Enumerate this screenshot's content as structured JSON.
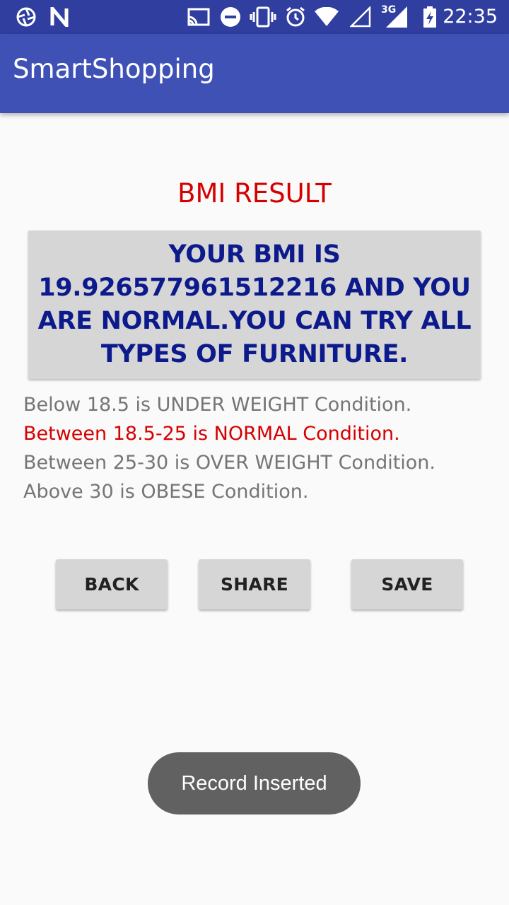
{
  "status_bar": {
    "time": "22:35",
    "network_type": "3G",
    "icons": [
      "aperture-icon",
      "n-icon",
      "cast-icon",
      "dnd-icon",
      "vibrate-icon",
      "alarm-icon",
      "wifi-icon",
      "signal-empty-icon",
      "signal-3g-icon",
      "battery-charging-icon"
    ]
  },
  "app_bar": {
    "title": "SmartShopping"
  },
  "content": {
    "heading": "BMI RESULT",
    "result_message": "YOUR BMI IS 19.926577961512216 AND  YOU ARE NORMAL.YOU CAN TRY ALL TYPES OF FURNITURE.",
    "conditions": [
      {
        "text": "Below 18.5 is UNDER WEIGHT Condition.",
        "highlighted": false
      },
      {
        "text": "Between 18.5-25 is NORMAL Condition.",
        "highlighted": true
      },
      {
        "text": "Between 25-30 is OVER WEIGHT Condition.",
        "highlighted": false
      },
      {
        "text": "Above 30 is OBESE Condition.",
        "highlighted": false
      }
    ]
  },
  "buttons": {
    "back": "BACK",
    "share": "SHARE",
    "save": "SAVE"
  },
  "toast": {
    "message": "Record Inserted"
  },
  "colors": {
    "status_bar": "#303f9f",
    "app_bar": "#3f51b5",
    "heading": "#d50000",
    "result_text": "#0d1a8c",
    "highlight": "#d50000"
  }
}
